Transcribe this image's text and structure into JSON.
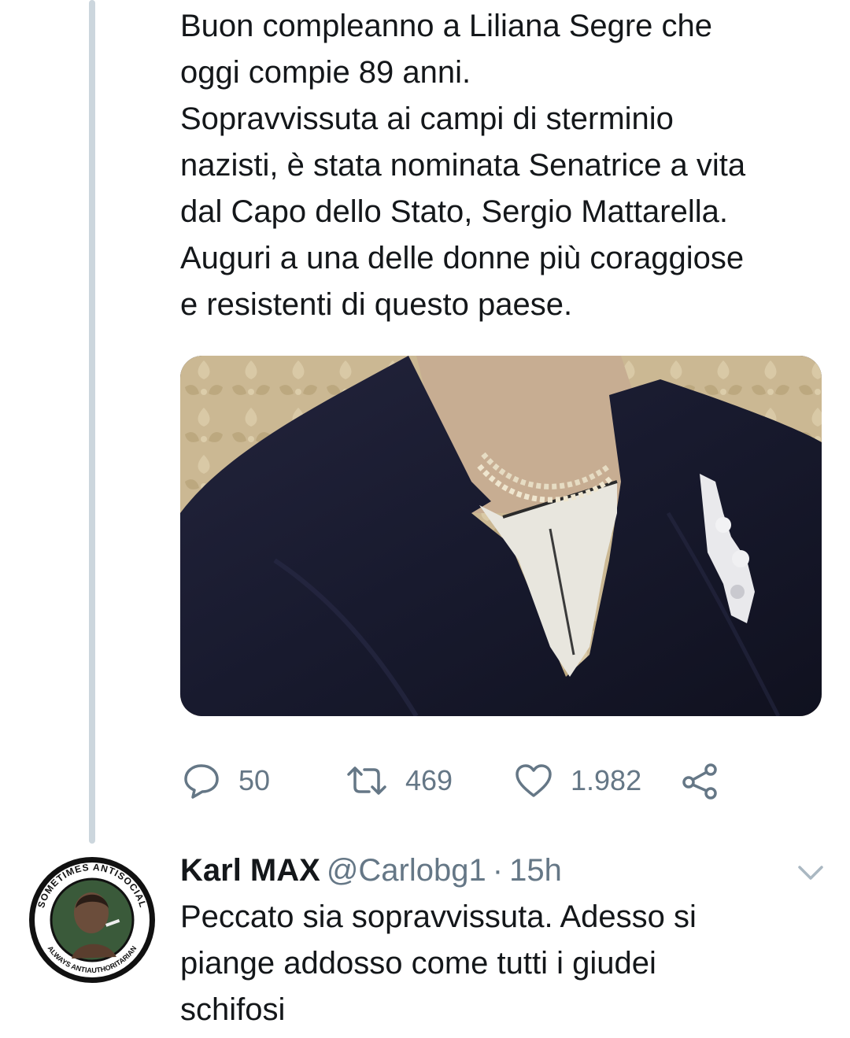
{
  "tweet": {
    "lines": [
      "Buon compleanno a Liliana Segre che",
      "oggi compie 89 anni.",
      "Sopravvissuta ai campi di sterminio",
      "nazisti, è stata nominata Senatrice a vita",
      "dal Capo dello Stato, Sergio Mattarella.",
      "Auguri a una delle donne più coraggiose",
      "e resistenti di questo paese."
    ],
    "actions": {
      "reply_icon": "reply-bubble-icon",
      "reply_count": "50",
      "retweet_icon": "retweet-icon",
      "retweet_count": "469",
      "like_icon": "heart-icon",
      "like_count": "1.982",
      "share_icon": "share-icon"
    }
  },
  "reply": {
    "avatar_ring_top": "SOMETIMES ANTISOCIAL",
    "avatar_ring_bottom": "ALWAYS ANTIAUTHORITARIAN",
    "name": "Karl MAX",
    "handle": "@Carlobg1",
    "separator": "·",
    "time": "15h",
    "menu_icon": "chevron-down-icon",
    "lines": [
      "Peccato sia sopravvissuta. Adesso si",
      "piange addosso come tutti i giudei",
      "schifosi"
    ]
  },
  "colors": {
    "text": "#14171a",
    "secondary": "#657786",
    "thread_line": "#ccd6dd",
    "background": "#ffffff"
  }
}
